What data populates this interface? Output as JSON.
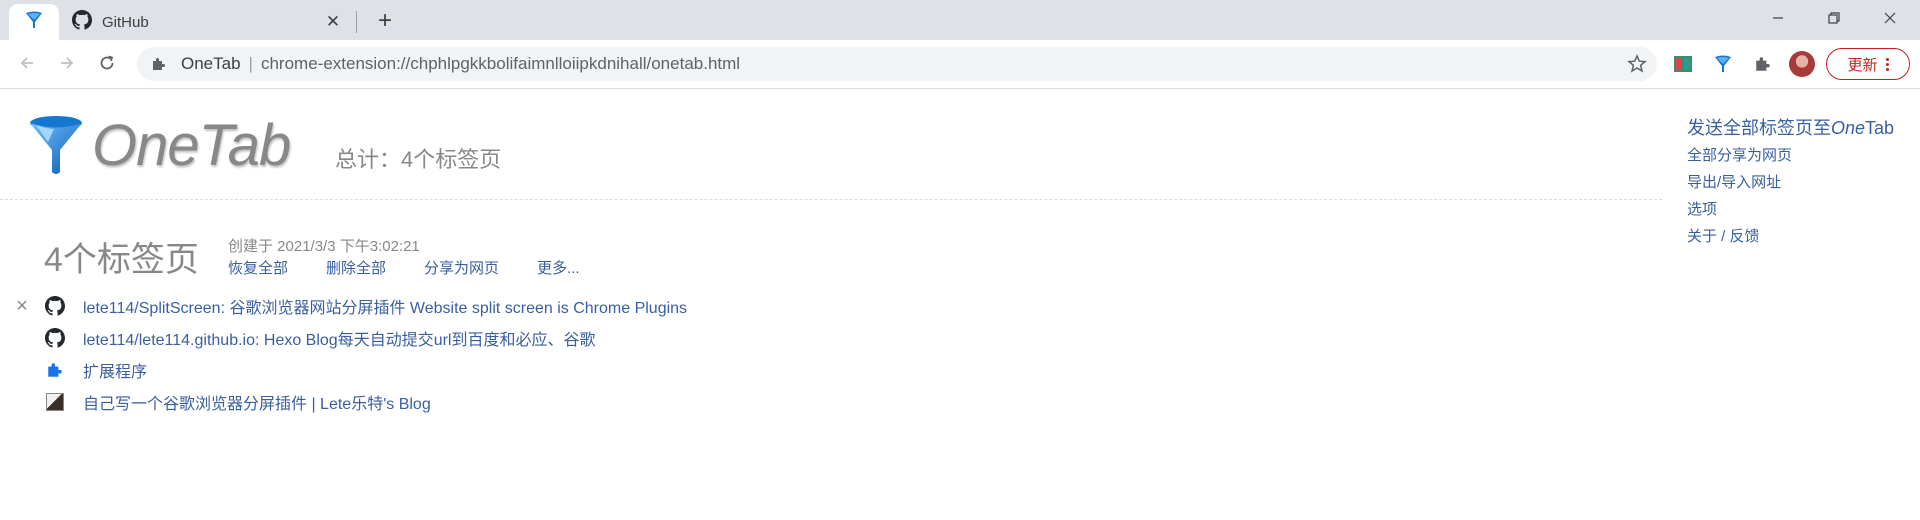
{
  "browser": {
    "tabs": [
      {
        "label": "",
        "icon": "onetab-funnel-icon",
        "active": true
      },
      {
        "label": "GitHub",
        "icon": "github-icon",
        "active": false
      }
    ],
    "omnibox": {
      "site_label": "OneTab",
      "separator": "|",
      "url": "chrome-extension://chphlpgkkbolifaimnlloiipkdnihall/onetab.html"
    },
    "update_button_label": "更新",
    "colors": {
      "accent_red": "#c5221f",
      "tabstrip_bg": "#dee1e6"
    }
  },
  "onetab": {
    "logo_text": "OneTab",
    "total_label": "总计：4个标签页",
    "right_menu": {
      "send_all_prefix": "发送全部标签页至",
      "send_all_brand_one": "One",
      "send_all_brand_tab": "Tab",
      "share_all": "全部分享为网页",
      "export_import": "导出/导入网址",
      "options": "选项",
      "about": "关于 / 反馈"
    },
    "group": {
      "title": "4个标签页",
      "created": "创建于 2021/3/3 下午3:02:21",
      "actions": [
        "恢复全部",
        "删除全部",
        "分享为网页",
        "更多..."
      ]
    },
    "tabs": [
      {
        "title": "lete114/SplitScreen: 谷歌浏览器网站分屏插件 Website split screen is Chrome Plugins",
        "icon": "github-icon"
      },
      {
        "title": "lete114/lete114.github.io: Hexo Blog每天自动提交url到百度和必应、谷歌",
        "icon": "github-icon"
      },
      {
        "title": "扩展程序",
        "icon": "puzzle-icon"
      },
      {
        "title": "自己写一个谷歌浏览器分屏插件 | Lete乐特's Blog",
        "icon": "blog-thumbnail-icon"
      }
    ],
    "colors": {
      "link": "#3a5fa0",
      "muted": "#888888"
    }
  }
}
